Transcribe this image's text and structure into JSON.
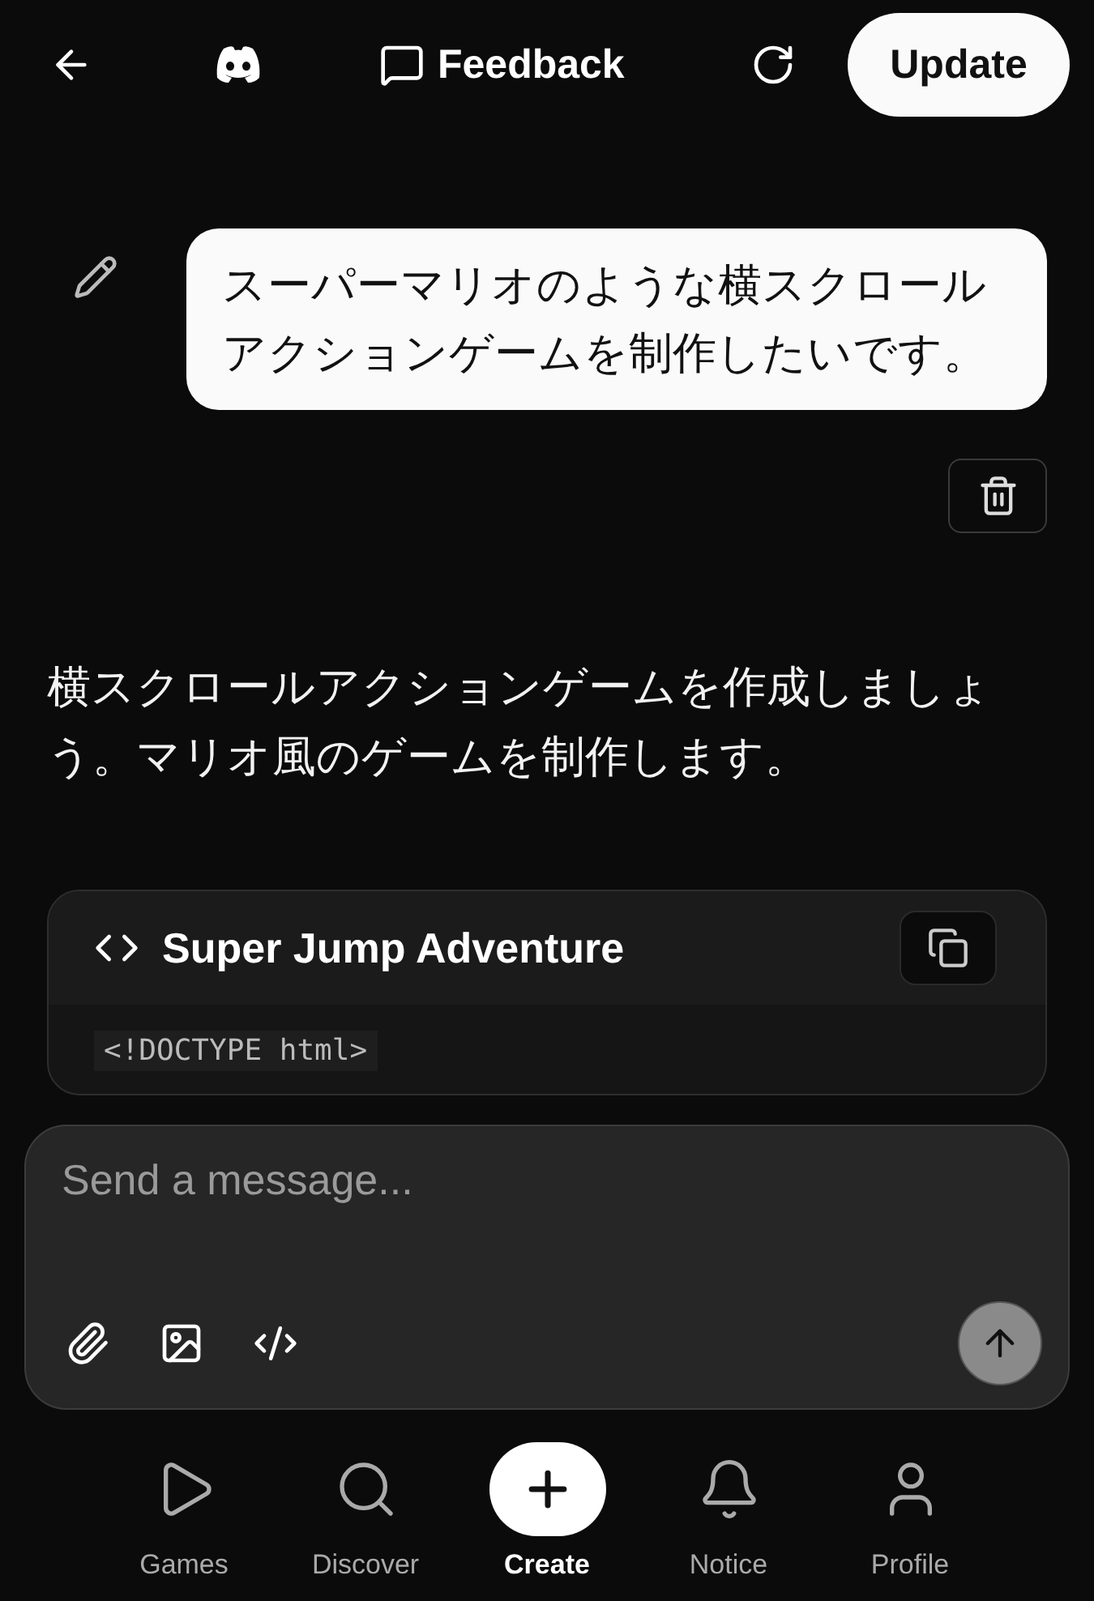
{
  "header": {
    "feedback_label": "Feedback",
    "update_label": "Update"
  },
  "user_message": "スーパーマリオのような横スクロールアクションゲームを制作したいです。",
  "assistant_message": "横スクロールアクションゲームを作成しましょう。マリオ風のゲームを制作します。",
  "code_block": {
    "title": "Super Jump Adventure",
    "code_line": "<!DOCTYPE html>"
  },
  "composer": {
    "placeholder": "Send a message..."
  },
  "nav": [
    {
      "label": "Games",
      "selected": false
    },
    {
      "label": "Discover",
      "selected": false
    },
    {
      "label": "Create",
      "selected": true
    },
    {
      "label": "Notice",
      "selected": false
    },
    {
      "label": "Profile",
      "selected": false
    }
  ]
}
